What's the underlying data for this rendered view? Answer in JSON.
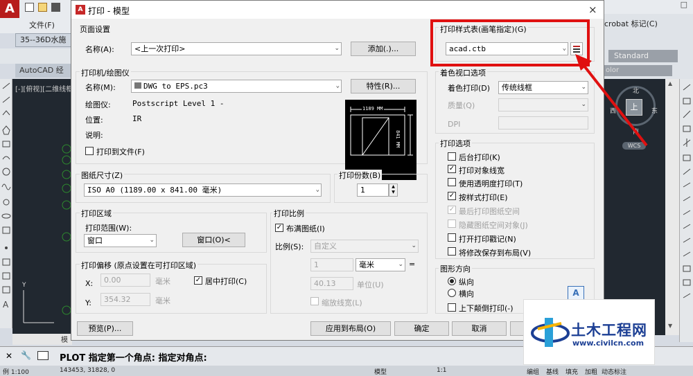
{
  "app": {
    "menu_file": "文件(F)",
    "doc_tab": "35--36D水施",
    "workspace": "AutoCAD 经典",
    "right_toolbar": "crobat 标记(C)",
    "style_combo": "Standard",
    "color_combo": "olor",
    "view_label": "[-][俯视][二维线框",
    "compass": {
      "n": "北",
      "s": "南",
      "e": "东",
      "w": "西",
      "center": "上",
      "wcs": "WCS"
    },
    "model_tab": "模",
    "cmd_prompt": "PLOT 指定第一个角点: 指定对角点:",
    "status": {
      "scale": "例 1:100",
      "coords": "143453, 31828, 0",
      "model": "模型",
      "ratio": "1:1",
      "edit": "编组",
      "baseline": "基线",
      "fill": "填充",
      "bold": "加粗",
      "dynamic": "动态标注"
    }
  },
  "dialog": {
    "title": "打印 - 模型",
    "close": "×",
    "page_setup": {
      "group": "页面设置",
      "name_label": "名称(A):",
      "name_value": "<上一次打印>",
      "add_button": "添加(.)..."
    },
    "printer": {
      "group": "打印机/绘图仪",
      "name_label": "名称(M):",
      "name_value": "DWG to EPS.pc3",
      "props_button": "特性(R)...",
      "plotter_label": "绘图仪:",
      "plotter_value": "Postscript Level 1 -",
      "location_label": "位置:",
      "location_value": "IR",
      "desc_label": "说明:",
      "print_to_file": "打印到文件(F)",
      "preview_width": "1189 MM",
      "preview_height": "841 MM"
    },
    "paper": {
      "group": "图纸尺寸(Z)",
      "value": "ISO A0 (1189.00 x 841.00 毫米)"
    },
    "copies": {
      "group": "打印份数(B)",
      "value": "1"
    },
    "area": {
      "group": "打印区域",
      "range_label": "打印范围(W):",
      "range_value": "窗口",
      "window_button": "窗口(O)<"
    },
    "scale": {
      "group": "打印比例",
      "fit": "布满图纸(I)",
      "ratio_label": "比例(S):",
      "ratio_value": "自定义",
      "v1": "1",
      "unit": "毫米",
      "eq": "=",
      "v2": "40.13",
      "unit2": "单位(U)",
      "lineweights": "缩放线宽(L)"
    },
    "offset": {
      "group": "打印偏移 (原点设置在可打印区域)",
      "x_label": "X:",
      "x_value": "0.00",
      "x_unit": "毫米",
      "y_label": "Y:",
      "y_value": "354.32",
      "y_unit": "毫米",
      "center": "居中打印(C)"
    },
    "style_table": {
      "group": "打印样式表(画笔指定)(G)",
      "value": "acad.ctb"
    },
    "shaded": {
      "group": "着色视口选项",
      "shade_label": "着色打印(D)",
      "shade_value": "传统线框",
      "quality_label": "质量(Q)",
      "dpi_label": "DPI"
    },
    "options": {
      "group": "打印选项",
      "items": [
        "后台打印(K)",
        "打印对象线宽",
        "使用透明度打印(T)",
        "按样式打印(E)",
        "最后打印图纸空间",
        "隐藏图纸空间对象(J)",
        "打开打印戳记(N)",
        "将修改保存到布局(V)"
      ]
    },
    "orientation": {
      "group": "图形方向",
      "portrait": "纵向",
      "landscape": "横向",
      "upside": "上下颠倒打印(-)",
      "icon": "A"
    },
    "buttons": {
      "preview": "预览(P)...",
      "apply": "应用到布局(O)",
      "ok": "确定",
      "cancel": "取消"
    }
  },
  "watermark": {
    "title": "土木工程网",
    "url": "www.civilcn.com"
  },
  "colors": {
    "highlight": "#e01010",
    "canvas": "#212830",
    "watermark_blue": "#1c3f94"
  }
}
